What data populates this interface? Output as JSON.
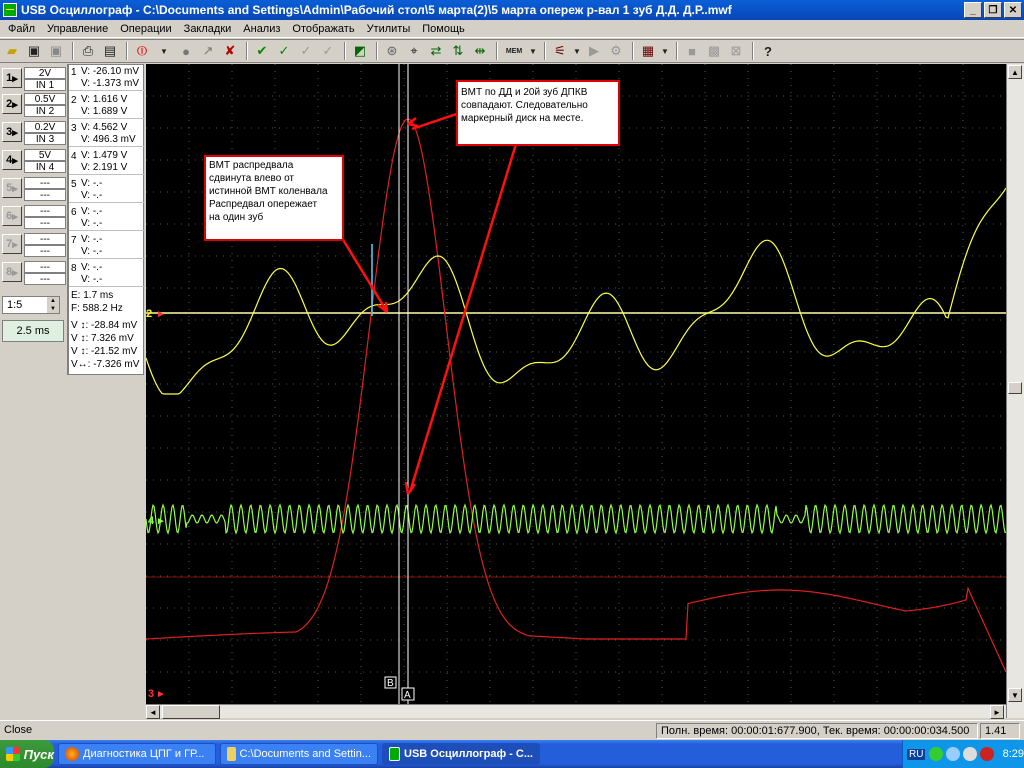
{
  "window": {
    "title": "USB Осциллограф - C:\\Documents and Settings\\Admin\\Рабочий стол\\5 марта(2)\\5 марта опереж р-вал 1 зуб Д.Д. Д.Р..mwf",
    "minimize": "_",
    "maximize": "❐",
    "close": "✕"
  },
  "menu": [
    "Файл",
    "Управление",
    "Операции",
    "Закладки",
    "Анализ",
    "Отображать",
    "Утилиты",
    "Помощь"
  ],
  "toolbar": {
    "mem_label": "MEM"
  },
  "channels": [
    {
      "num": "1",
      "volts": "2V",
      "input": "IN 1",
      "enabled": true
    },
    {
      "num": "2",
      "volts": "0.5V",
      "input": "IN 2",
      "enabled": true
    },
    {
      "num": "3",
      "volts": "0.2V",
      "input": "IN 3",
      "enabled": true
    },
    {
      "num": "4",
      "volts": "5V",
      "input": "IN 4",
      "enabled": true
    },
    {
      "num": "5",
      "volts": "---",
      "input": "---",
      "enabled": false
    },
    {
      "num": "6",
      "volts": "---",
      "input": "---",
      "enabled": false
    },
    {
      "num": "7",
      "volts": "---",
      "input": "---",
      "enabled": false
    },
    {
      "num": "8",
      "volts": "---",
      "input": "---",
      "enabled": false
    }
  ],
  "scale": {
    "ratio": "1:5",
    "time": "2.5 ms"
  },
  "readings": [
    {
      "num": "1",
      "a": "V: -26.10 mV",
      "b": "V: -1.373 mV"
    },
    {
      "num": "2",
      "a": "V:   1.616 V",
      "b": "V:   1.689 V"
    },
    {
      "num": "3",
      "a": "V:   4.562 V",
      "b": "V: 496.3 mV"
    },
    {
      "num": "4",
      "a": "V:   1.479 V",
      "b": "V:   2.191 V"
    },
    {
      "num": "5",
      "a": "V:       -.-",
      "b": "V:       -.-"
    },
    {
      "num": "6",
      "a": "V:       -.-",
      "b": "V:       -.-"
    },
    {
      "num": "7",
      "a": "V:       -.-",
      "b": "V:       -.-"
    },
    {
      "num": "8",
      "a": "V:       -.-",
      "b": "V:       -.-"
    }
  ],
  "timing": {
    "e": "E:      1.7 ms",
    "f": "F:  588.2 Hz"
  },
  "deltas": [
    "V ↕: -28.84 mV",
    "V ↕:  7.326 mV",
    "V ↕: -21.52 mV",
    "V↔: -7.326 mV"
  ],
  "markers": {
    "b": "B",
    "a": "A"
  },
  "trace_labels": {
    "ch2": "2",
    "ch4": "4",
    "ch3": "3"
  },
  "annotations": {
    "left": [
      "ВМТ распредвала",
      "сдвинута влево от",
      "истинной ВМТ коленвала",
      "Распредвал опережает",
      "на один зуб"
    ],
    "right": [
      "ВМТ по ДД и 20й зуб ДПКВ",
      "совпадают. Следовательно",
      "маркерный диск на месте."
    ]
  },
  "status": {
    "left": "Close",
    "times": "Полн. время: 00:00:01:677.900,  Тек. время: 00:00:00:034.500",
    "zoom": "1.41"
  },
  "taskbar": {
    "start": "Пуск",
    "tasks": [
      "Диагностика ЦПГ и ГР...",
      "C:\\Documents and Settin...",
      "USB Осциллограф - С..."
    ],
    "lang": "RU",
    "clock": "8:29"
  },
  "colors": {
    "plot_bg": "#000000",
    "grid": "#3a6a3a",
    "ch2_yellow": "#ffff40",
    "ch4_green": "#90ff40",
    "ch3_red": "#e02020",
    "callout_border": "#e00000"
  }
}
